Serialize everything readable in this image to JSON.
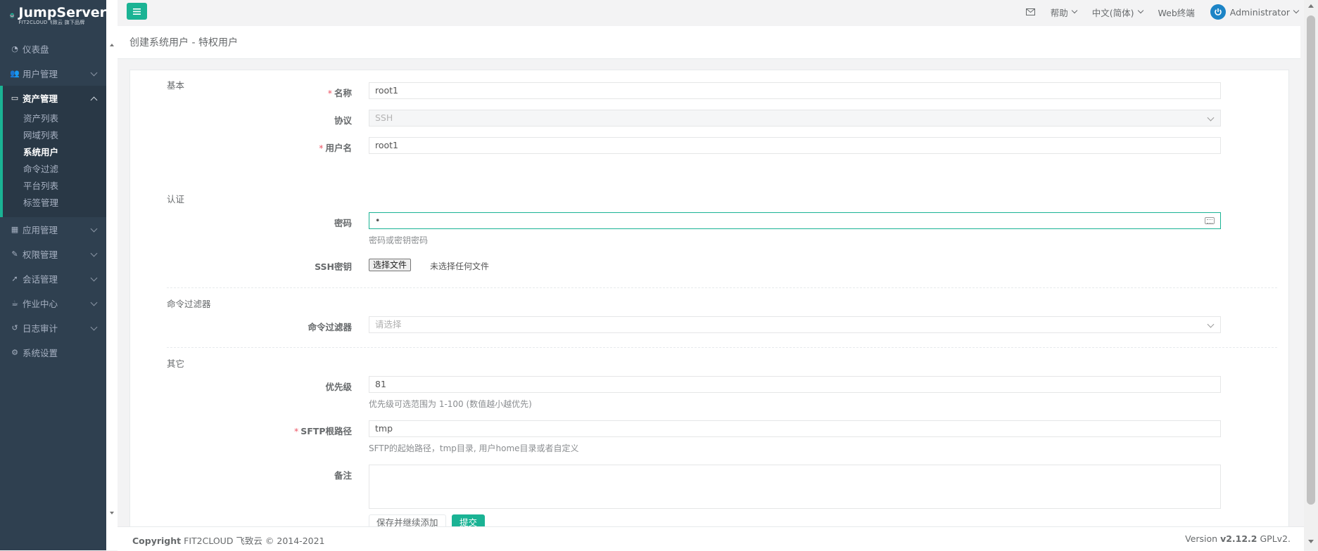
{
  "brand": {
    "name": "JumpServer",
    "subtitle": "FIT2CLOUD飞致云 旗下品牌"
  },
  "sidebar": {
    "items": [
      {
        "label": "仪表盘",
        "icon": "dashboard-icon"
      },
      {
        "label": "用户管理",
        "icon": "users-icon"
      },
      {
        "label": "资产管理",
        "icon": "inbox-icon"
      },
      {
        "label": "应用管理",
        "icon": "grid-icon"
      },
      {
        "label": "权限管理",
        "icon": "edit-icon"
      },
      {
        "label": "会话管理",
        "icon": "rocket-icon"
      },
      {
        "label": "作业中心",
        "icon": "coffee-icon"
      },
      {
        "label": "日志审计",
        "icon": "history-icon"
      },
      {
        "label": "系统设置",
        "icon": "cogs-icon"
      }
    ],
    "asset_sub": [
      "资产列表",
      "网域列表",
      "系统用户",
      "命令过滤",
      "平台列表",
      "标签管理"
    ]
  },
  "topbar": {
    "help": "帮助",
    "language": "中文(简体)",
    "web_terminal": "Web终端",
    "user": "Administrator"
  },
  "page": {
    "title": "创建系统用户 - 特权用户"
  },
  "form": {
    "section_basic": "基本",
    "name_label": "名称",
    "name_value": "root1",
    "protocol_label": "协议",
    "protocol_value": "SSH",
    "username_label": "用户名",
    "username_value": "root1",
    "section_auth": "认证",
    "password_label": "密码",
    "password_value": "•",
    "password_help": "密码或密钥密码",
    "ssh_key_label": "SSH密钥",
    "file_button": "选择文件",
    "file_none": "未选择任何文件",
    "section_cmd": "命令过滤器",
    "cmd_label": "命令过滤器",
    "cmd_placeholder": "请选择",
    "section_other": "其它",
    "priority_label": "优先级",
    "priority_value": "81",
    "priority_help": "优先级可选范围为 1-100 (数值越小越优先)",
    "sftp_label": "SFTP根路径",
    "sftp_value": "tmp",
    "sftp_help": "SFTP的起始路径，tmp目录, 用户home目录或者自定义",
    "comment_label": "备注",
    "save_continue": "保存并继续添加",
    "submit": "提交"
  },
  "footer": {
    "copyright_strong": "Copyright",
    "copyright_rest": "FIT2CLOUD 飞致云 © 2014-2021",
    "version_prefix": "Version",
    "version_num": "v2.12.2",
    "license": "GPLv2."
  },
  "colors": {
    "sidebar": "#2f4050",
    "accent": "#1ab394",
    "required": "#ed5565",
    "avatar": "#1c84c6"
  }
}
